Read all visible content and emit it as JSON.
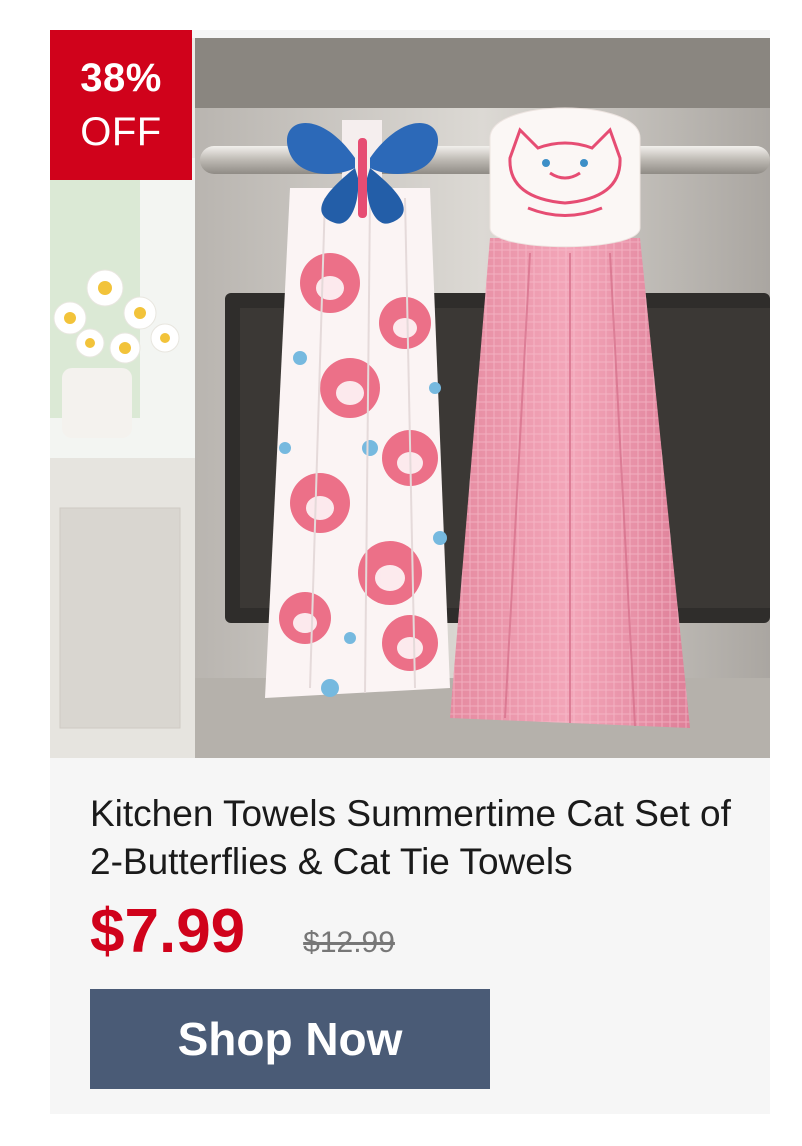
{
  "badge": {
    "percent": "38%",
    "off": "OFF"
  },
  "product": {
    "title": "Kitchen Towels Summertime Cat Set of 2-Butterflies & Cat Tie Towels",
    "price": "$7.99",
    "original_price": "$12.99",
    "image_icon": "towels-photo"
  },
  "cta": {
    "label": "Shop Now"
  },
  "colors": {
    "badge": "#d0021b",
    "price": "#d0021b",
    "button": "#4a5b76"
  }
}
